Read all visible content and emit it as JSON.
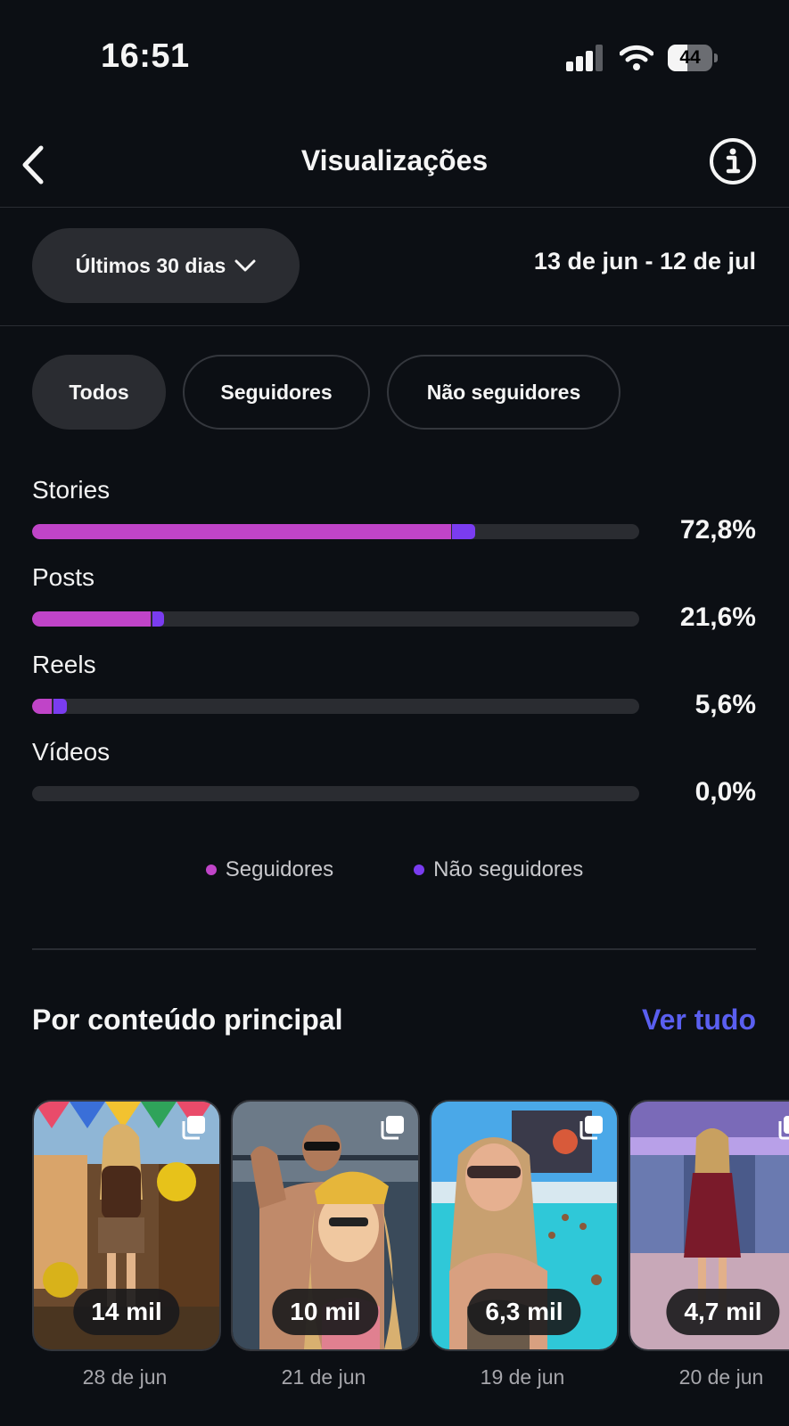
{
  "status_bar": {
    "time": "16:51",
    "battery_level": "44",
    "battery_fraction": 0.44
  },
  "nav": {
    "title": "Visualizações"
  },
  "filters": {
    "period_label": "Últimos 30 dias",
    "date_range": "13 de jun - 12 de jul"
  },
  "audience_tabs": [
    {
      "label": "Todos",
      "active": true
    },
    {
      "label": "Seguidores",
      "active": false
    },
    {
      "label": "Não seguidores",
      "active": false
    }
  ],
  "content_breakdown": [
    {
      "label": "Stories",
      "percent_text": "72,8%",
      "followers_pct": 69.0,
      "non_followers_pct": 3.8
    },
    {
      "label": "Posts",
      "percent_text": "21,6%",
      "followers_pct": 19.6,
      "non_followers_pct": 2.0
    },
    {
      "label": "Reels",
      "percent_text": "5,6%",
      "followers_pct": 3.3,
      "non_followers_pct": 2.3
    },
    {
      "label": "Vídeos",
      "percent_text": "0,0%",
      "followers_pct": 0,
      "non_followers_pct": 0
    }
  ],
  "legend": [
    {
      "label": "Seguidores",
      "color": "#c044c8"
    },
    {
      "label": "Não seguidores",
      "color": "#7a3cf0"
    }
  ],
  "top_content": {
    "title": "Por conteúdo principal",
    "see_all_label": "Ver tudo",
    "items": [
      {
        "views": "14 mil",
        "date": "28 de jun"
      },
      {
        "views": "10 mil",
        "date": "21 de jun"
      },
      {
        "views": "6,3 mil",
        "date": "19 de jun"
      },
      {
        "views": "4,7 mil",
        "date": "20 de jun"
      }
    ]
  },
  "colors": {
    "accent": "#5a5ff0",
    "followers": "#c044c8",
    "non_followers": "#7a3cf0",
    "background": "#0c0f14"
  }
}
